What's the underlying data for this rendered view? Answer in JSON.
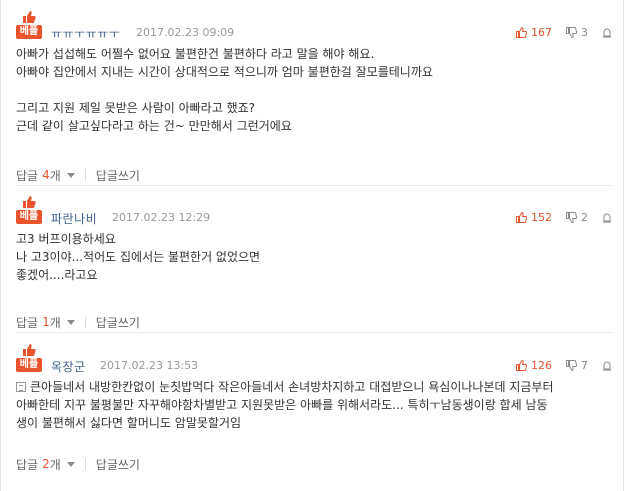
{
  "badge_label": "베플",
  "reply_label": "답글",
  "reply_unit": "개",
  "write_reply_label": "답글쓰기",
  "colors": {
    "accent": "#e8542e",
    "nickname": "#3b5f8e",
    "muted": "#9a9a9a"
  },
  "comments": [
    {
      "nickname": "ㅠㅠㅜㅠㅠㅜ",
      "date": "2017.02.23 09:09",
      "upvotes": "167",
      "downvotes": "3",
      "lines": [
        "아빠가 섭섭해도 어쩔수 없어요 불편한건 불편하다 라고 말을 해야 해요.",
        "아빠야 집안에서 지내는 시간이 상대적으로 적으니까 엄마 불편한걸 잘모를테니까요",
        "",
        "그리고 지원 제일 못받은 사람이 아빠라고 했죠?",
        "근데 같이 살고싶다라고 하는 건~ 만만해서 그런거에요"
      ],
      "reply_count": "4"
    },
    {
      "nickname": "파란나비",
      "date": "2017.02.23 12:29",
      "upvotes": "152",
      "downvotes": "2",
      "lines": [
        "고3 버프이용하세요",
        "나 고3이야...적어도 집에서는 불편한거 없었으면",
        "좋겠어....라고요"
      ],
      "reply_count": "1"
    },
    {
      "nickname": "옥장군",
      "date": "2017.02.23 13:53",
      "upvotes": "126",
      "downvotes": "7",
      "lines": [
        "큰아들네서 내방한칸없이 눈칫밥먹다 작은아들네서 손녀방차지하고 대접받으니 욕심이나나본데 지금부터",
        "아빠한테 지꾸 불평불만 자꾸해야함차별받고 지원못받은 아빠를 위해서라도... 특히ㅜ남동생이랑 합세 남동",
        "생이 불편해서 싫다면 할머니도 암말못할거임"
      ],
      "reply_count": "2"
    }
  ]
}
